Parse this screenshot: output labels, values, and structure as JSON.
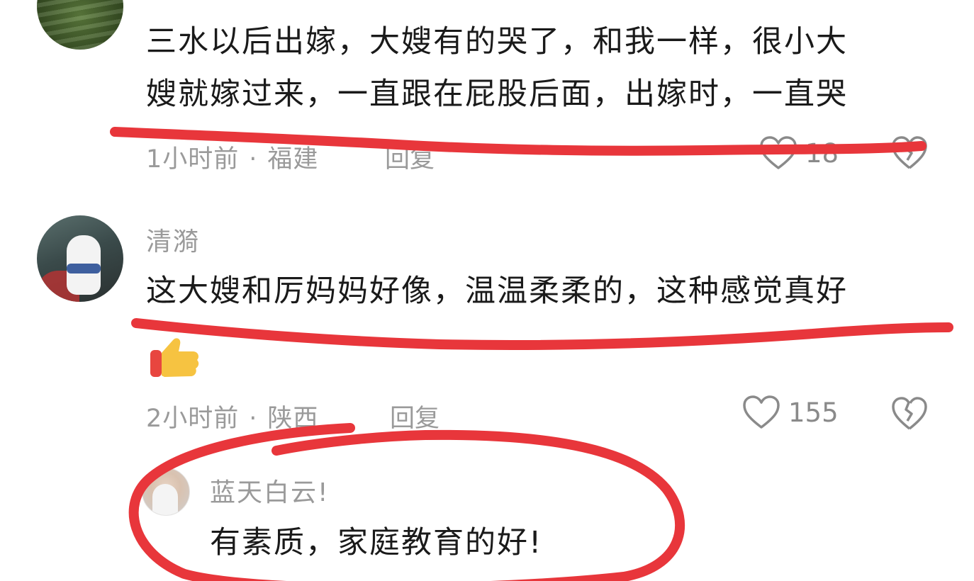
{
  "comments": [
    {
      "text_line1": "三水以后出嫁，大嫂有的哭了，和我一样，很小大",
      "text_line2": "嫂就嫁过来，一直跟在屁股后面，出嫁时，一直哭",
      "time": "1小时前",
      "location": "福建",
      "reply_label": "回复",
      "like_count": "18"
    },
    {
      "username": "清漪",
      "text": "这大嫂和厉妈妈好像，温温柔柔的，这种感觉真好",
      "time": "2小时前",
      "location": "陕西",
      "reply_label": "回复",
      "like_count": "155"
    }
  ],
  "reply": {
    "username": "蓝天白云!",
    "text": "有素质，家庭教育的好!"
  },
  "separator": "·",
  "icons": {
    "like": "heart-outline-icon",
    "dislike": "broken-heart-icon",
    "emoji": "thumbs-up-emoji"
  },
  "colors": {
    "annotation_red": "#e8363b",
    "meta_gray": "#9a9a9a",
    "text": "#1a1a1a"
  }
}
